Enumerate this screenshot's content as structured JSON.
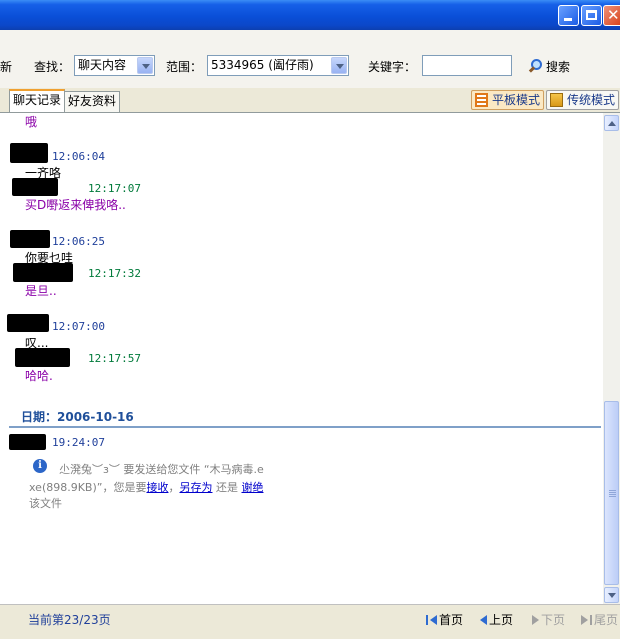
{
  "toolbar": {
    "cut_label": "新",
    "find_label": "查找：",
    "find_option": "聊天内容",
    "scope_label": "范围：",
    "scope_value": "5334965 (阖仔雨)",
    "keyword_label": "关键字：",
    "keyword_value": "",
    "search_label": "搜索"
  },
  "tabs": [
    {
      "label": "聊天记录",
      "active": true
    },
    {
      "label": "好友资料",
      "active": false
    }
  ],
  "modes": {
    "flat_label": "平板模式",
    "traditional_label": "传统模式"
  },
  "messages": {
    "m0_text": "哦",
    "m1_time": "12:06:04",
    "m1_text": "一齐咯",
    "m2_time": "12:17:07",
    "m2_text": "买D嘢返来俾我咯..",
    "m3_time": "12:06:25",
    "m3_text": "你要乜哇",
    "m4_time": "12:17:32",
    "m4_text": "是旦..",
    "m5_time": "12:07:00",
    "m5_text": "叹...",
    "m6_time": "12:17:57",
    "m6_text": "哈哈."
  },
  "date_section": {
    "header": "日期：2006-10-16",
    "time": "19:24:07",
    "line1": "尐溌兔︶з︶ 要发送给您文件 “木马病毒.e",
    "line2_prefix": "xe(898.9KB)”，您是要",
    "accept": "接收",
    "sep1": "，",
    "save_as": "另存为",
    "or": " 还是 ",
    "decline": "谢绝",
    "line3": "该文件"
  },
  "status": {
    "page_info": "当前第23/23页",
    "first": "首页",
    "prev": "上页",
    "next": "下页",
    "last": "尾页"
  },
  "colors": {
    "titlebar": "#0a4fd8",
    "time_self": "#1f3f9a",
    "time_friend": "#007a3a",
    "friend_text": "#8a00a8",
    "date_header": "#1f4f9a"
  }
}
